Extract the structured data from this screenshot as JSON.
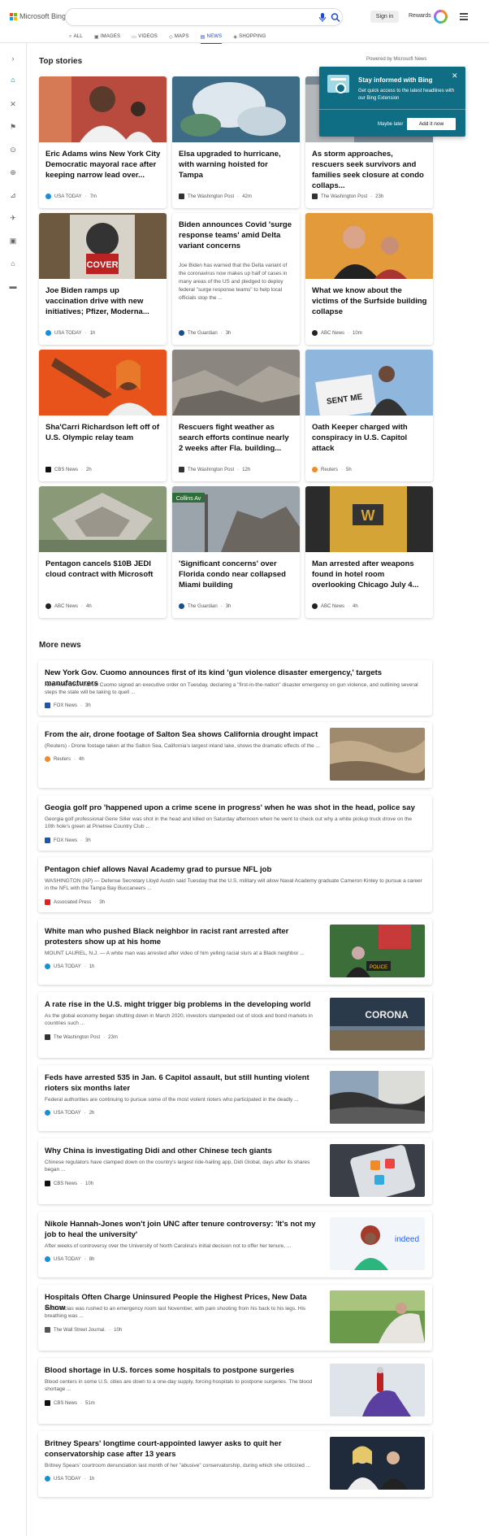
{
  "header": {
    "brand": "Microsoft Bing",
    "search_value": "",
    "sign_in": "Sign in",
    "rewards": "Rewards",
    "scopes": [
      {
        "label": "ALL",
        "icon": "search-icon",
        "active": false
      },
      {
        "label": "IMAGES",
        "icon": "images-icon",
        "active": false
      },
      {
        "label": "VIDEOS",
        "icon": "videos-icon",
        "active": false
      },
      {
        "label": "MAPS",
        "icon": "maps-icon",
        "active": false
      },
      {
        "label": "NEWS",
        "icon": "news-icon",
        "active": true
      },
      {
        "label": "SHOPPING",
        "icon": "shopping-icon",
        "active": false
      }
    ]
  },
  "top_stories": {
    "title": "Top stories",
    "powered_by": "Powered by Microsoft News",
    "cards": [
      {
        "title": "Eric Adams wins New York City Democratic mayoral race after keeping narrow lead over...",
        "source": "USA TODAY",
        "time": "7m"
      },
      {
        "title": "Elsa upgraded to hurricane, with warning hoisted for Tampa",
        "source": "The Washington Post",
        "time": "42m"
      },
      {
        "title": "As storm approaches, rescuers seek survivors and families seek closure at condo collaps...",
        "source": "The Washington Post",
        "time": "23h"
      },
      {
        "title": "Joe Biden ramps up vaccination drive with new initiatives; Pfizer, Moderna...",
        "source": "USA TODAY",
        "time": "1h"
      },
      {
        "title": "Biden announces Covid 'surge response teams' amid Delta variant concerns",
        "snippet": "Joe Biden has warned that the Delta variant of the coronavirus now makes up half of cases in many areas of the US and pledged to deploy federal \"surge response teams\" to help local officials stop the ...",
        "source": "The Guardian",
        "time": "3h"
      },
      {
        "title": "What we know about the victims of the Surfside building collapse",
        "source": "ABC News",
        "time": "10m"
      },
      {
        "title": "Sha'Carri Richardson left off of U.S. Olympic relay team",
        "source": "CBS News",
        "time": "2h"
      },
      {
        "title": "Rescuers fight weather as search efforts continue nearly 2 weeks after Fla. building...",
        "source": "The Washington Post",
        "time": "12h"
      },
      {
        "title": "Oath Keeper charged with conspiracy in U.S. Capitol attack",
        "source": "Reuters",
        "time": "5h"
      },
      {
        "title": "Pentagon cancels $10B JEDI cloud contract with Microsoft",
        "source": "ABC News",
        "time": "4h"
      },
      {
        "title": "'Significant concerns' over Florida condo near collapsed Miami building",
        "source": "The Guardian",
        "time": "3h"
      },
      {
        "title": "Man arrested after weapons found in hotel room overlooking Chicago July 4...",
        "source": "ABC News",
        "time": "4h"
      }
    ],
    "image_texts": {
      "cover_sign": "COVER",
      "street_sign": "Collins Av",
      "hotel_letter": "W",
      "protest_sign": "SENT ME"
    }
  },
  "popup": {
    "title": "Stay informed with Bing",
    "description": "Get quick access to the latest headlines with our Bing Extension",
    "maybe_later": "Maybe later",
    "add_now": "Add it now",
    "close": "✕"
  },
  "more_news": {
    "title": "More news",
    "items": [
      {
        "title": "New York Gov. Cuomo announces first of its kind 'gun violence disaster emergency,' targets manufacturers",
        "desc": "New York Gov. Andrew Cuomo signed an executive order on Tuesday, declaring a \"first-in-the-nation\" disaster emergency on gun violence, and outlining several steps the state will be taking to quell ...",
        "source": "FOX News",
        "time": "3h"
      },
      {
        "title": "From the air, drone footage of Salton Sea shows California drought impact",
        "desc": "(Reuters) - Drone footage taken at the Salton Sea, California's largest inland lake, shows the dramatic effects of the ...",
        "source": "Reuters",
        "time": "4h"
      },
      {
        "title": "Geogia golf pro 'happened upon a crime scene in progress' when he was shot in the head, police say",
        "desc": "Georgia golf professional Gene Siller was shot in the head and killed on Saturday afternoon when he went to check out why a white pickup truck drove on the 10th hole's green at Pinetree Country Club ...",
        "source": "FOX News",
        "time": "3h"
      },
      {
        "title": "Pentagon chief allows Naval Academy grad to pursue NFL job",
        "desc": "WASHINGTON (AP) — Defense Secretary Lloyd Austin said Tuesday that the U.S. military will allow Naval Academy graduate Cameron Kinley to pursue a career in the NFL with the Tampa Bay Buccaneers ...",
        "source": "Associated Press",
        "time": "3h"
      },
      {
        "title": "White man who pushed Black neighbor in racist rant arrested after protesters show up at his home",
        "desc": "MOUNT LAUREL, N.J. — A white man was arrested after video of him yelling racial slurs at a Black neighbor ...",
        "source": "USA TODAY",
        "time": "1h"
      },
      {
        "title": "A rate rise in the U.S. might trigger big problems in the developing world",
        "desc": "As the global economy began shutting down in March 2020, investors stampeded out of stock and bond markets in countries such ...",
        "source": "The Washington Post",
        "time": "23m"
      },
      {
        "title": "Feds have arrested 535 in Jan. 6 Capitol assault, but still hunting violent rioters six months later",
        "desc": "Federal authorities are continuing to pursue some of the most violent rioters who participated in the deadly ...",
        "source": "USA TODAY",
        "time": "2h"
      },
      {
        "title": "Why China is investigating Didi and other Chinese tech giants",
        "desc": "Chinese regulators have clamped down on the country's largest ride-hailing app, Didi Global, days after its shares began ...",
        "source": "CBS News",
        "time": "10h"
      },
      {
        "title": "Nikole Hannah-Jones won't join UNC after tenure controversy: 'It's not my job to heal the university'",
        "desc": "After weeks of controversy over the University of North Carolina's initial decision not to offer her tenure, ...",
        "source": "USA TODAY",
        "time": "8h"
      },
      {
        "title": "Hospitals Often Charge Uninsured People the Highest Prices, New Data Show",
        "desc": "Raul Macias was rushed to an emergency room last November, with pain shooting from his back to his legs. His breathing was ...",
        "source": "The Wall Street Journal.",
        "time": "10h"
      },
      {
        "title": "Blood shortage in U.S. forces some hospitals to postpone surgeries",
        "desc": "Blood centers in some U.S. cities are down to a one-day supply, forcing hospitals to postpone surgeries. The blood shortage ...",
        "source": "CBS News",
        "time": "51m"
      },
      {
        "title": "Britney Spears' longtime court-appointed lawyer asks to quit her conservatorship case after 13 years",
        "desc": "Britney Spears' courtroom denunciation last month of her \"abusive\" conservatorship, during which she criticized ...",
        "source": "USA TODAY",
        "time": "1h"
      }
    ],
    "image_texts": {
      "police_shirt": "POLICE",
      "indeed_logo": "indeed",
      "graffiti": "CORONA"
    }
  },
  "colors": {
    "accent": "#174ae4",
    "teal": "#0f6e84"
  }
}
